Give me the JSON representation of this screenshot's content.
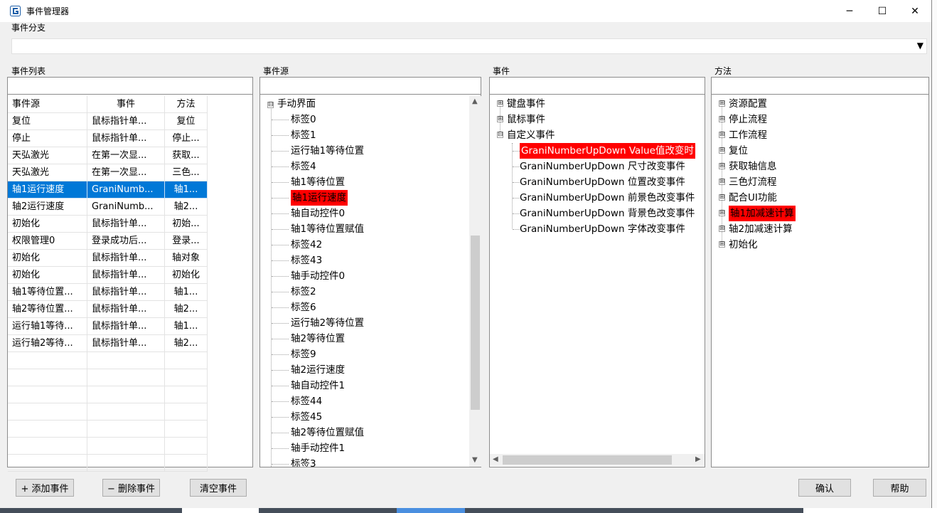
{
  "window": {
    "title": "事件管理器",
    "min": "─",
    "max": "☐",
    "close": "✕"
  },
  "branch": {
    "label": "事件分支",
    "value": "",
    "arrow": "▼"
  },
  "list": {
    "label": "事件列表",
    "headers": [
      "事件源",
      "事件",
      "方法"
    ],
    "rows": [
      [
        "复位",
        "鼠标指针单...",
        "复位"
      ],
      [
        "停止",
        "鼠标指针单...",
        "停止..."
      ],
      [
        "天弘激光",
        "在第一次显...",
        "获取..."
      ],
      [
        "天弘激光",
        "在第一次显...",
        "三色..."
      ],
      [
        "轴1运行速度",
        "GraniNumb...",
        "轴1..."
      ],
      [
        "轴2运行速度",
        "GraniNumb...",
        "轴2..."
      ],
      [
        "初始化",
        "鼠标指针单...",
        "初始..."
      ],
      [
        "权限管理0",
        "登录成功后...",
        "登录..."
      ],
      [
        "初始化",
        "鼠标指针单...",
        "轴对象"
      ],
      [
        "初始化",
        "鼠标指针单...",
        "初始化"
      ],
      [
        "轴1等待位置...",
        "鼠标指针单...",
        "轴1..."
      ],
      [
        "轴2等待位置...",
        "鼠标指针单...",
        "轴2..."
      ],
      [
        "运行轴1等待...",
        "鼠标指针单...",
        "轴1..."
      ],
      [
        "运行轴2等待...",
        "鼠标指针单...",
        "轴2..."
      ]
    ],
    "selected_index": 4
  },
  "source": {
    "label": "事件源",
    "root": "手动界面",
    "items": [
      "标签0",
      "标签1",
      "运行轴1等待位置",
      "标签4",
      "轴1等待位置",
      "轴1运行速度",
      "轴自动控件0",
      "轴1等待位置赋值",
      "标签42",
      "标签43",
      "轴手动控件0",
      "标签2",
      "标签6",
      "运行轴2等待位置",
      "轴2等待位置",
      "标签9",
      "轴2运行速度",
      "轴自动控件1",
      "标签44",
      "标签45",
      "轴2等待位置赋值",
      "轴手动控件1",
      "标签3"
    ],
    "highlighted_index": 5
  },
  "events": {
    "label": "事件",
    "groups": [
      "键盘事件",
      "鼠标事件",
      "自定义事件"
    ],
    "custom": [
      "GraniNumberUpDown Value值改变时",
      "GraniNumberUpDown 尺寸改变事件",
      "GraniNumberUpDown 位置改变事件",
      "GraniNumberUpDown 前景色改变事件",
      "GraniNumberUpDown 背景色改变事件",
      "GraniNumberUpDown 字体改变事件"
    ],
    "highlighted_index": 0
  },
  "methods": {
    "label": "方法",
    "items": [
      "资源配置",
      "停止流程",
      "工作流程",
      "复位",
      "获取轴信息",
      "三色灯流程",
      "配合UI功能",
      "轴1加减速计算",
      "轴2加减速计算",
      "初始化"
    ],
    "highlighted_index": 7
  },
  "buttons": {
    "add": "+  添加事件",
    "delete": "−  删除事件",
    "clear": "清空事件",
    "ok": "确认",
    "help": "帮助"
  },
  "colors": {
    "selection": "#0078d7",
    "highlight": "#ff0000"
  },
  "icons": {
    "expand": "⊞",
    "collapse": "⊟"
  }
}
